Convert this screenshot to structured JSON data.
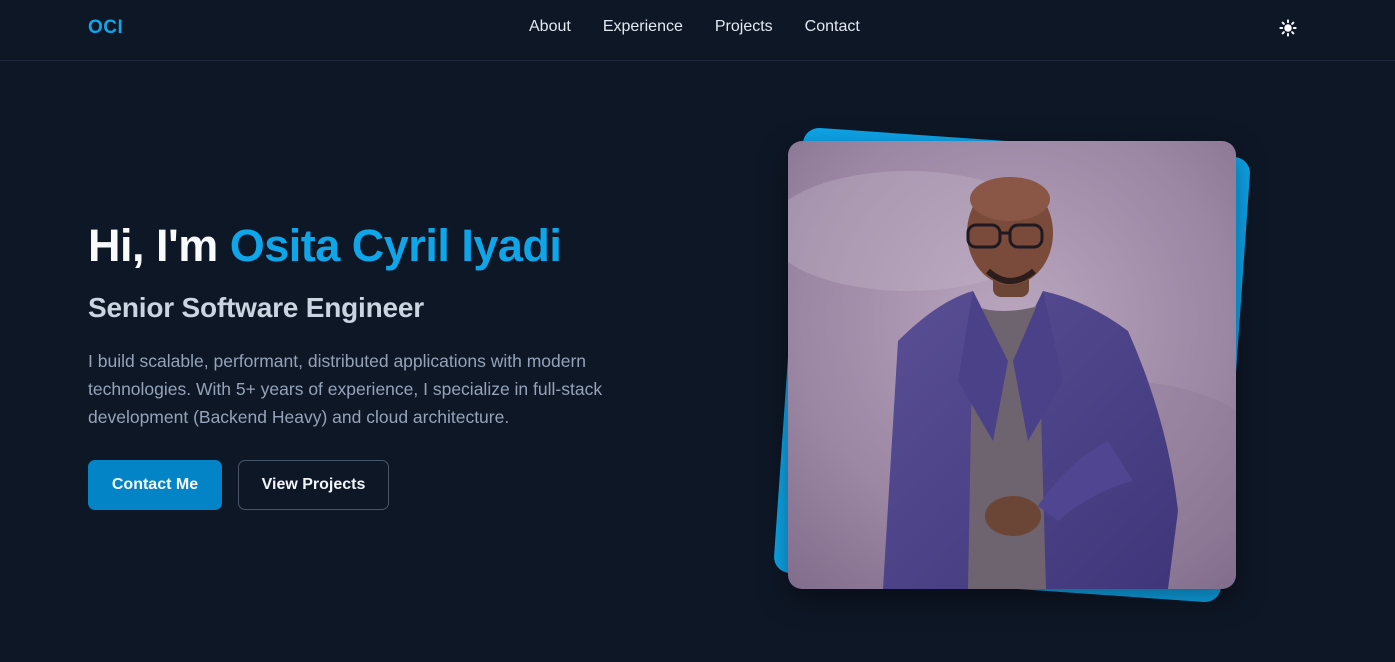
{
  "nav": {
    "logo": "OCI",
    "links": [
      "About",
      "Experience",
      "Projects",
      "Contact"
    ],
    "theme_icon": "sun-icon"
  },
  "hero": {
    "greeting_prefix": "Hi, I'm ",
    "name": "Osita Cyril Iyadi",
    "subtitle": "Senior Software Engineer",
    "bio": "I build scalable, performant, distributed applications with modern technologies. With 5+ years of experience, I specialize in full-stack development (Backend Heavy) and cloud architecture.",
    "primary_button": "Contact Me",
    "secondary_button": "View Projects"
  },
  "colors": {
    "background": "#0e1726",
    "accent": "#0ea5e9",
    "primary_button": "#0284c7"
  }
}
